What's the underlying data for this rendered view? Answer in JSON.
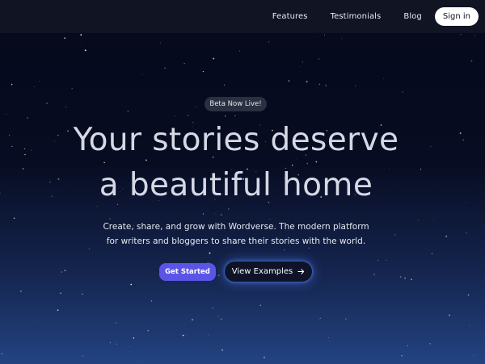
{
  "nav": {
    "links": [
      {
        "label": "Features"
      },
      {
        "label": "Testimonials"
      },
      {
        "label": "Blog"
      }
    ],
    "signin_label": "Sign in"
  },
  "hero": {
    "badge": "Beta Now Live!",
    "headline_line1": "Your stories deserve",
    "headline_line2": "a beautiful home",
    "subtitle_line1": "Create, share, and grow with Wordverse. The modern platform",
    "subtitle_line2": "for writers and bloggers to share their stories with the world.",
    "primary_cta": "Get Started",
    "secondary_cta": "View Examples",
    "secondary_icon": "arrow-right-icon"
  },
  "colors": {
    "primary_button": "#5a55e6",
    "secondary_glow": "#4c78eb",
    "nav_background": "#111423",
    "background_top": "#05091a",
    "background_bottom": "#234381"
  }
}
